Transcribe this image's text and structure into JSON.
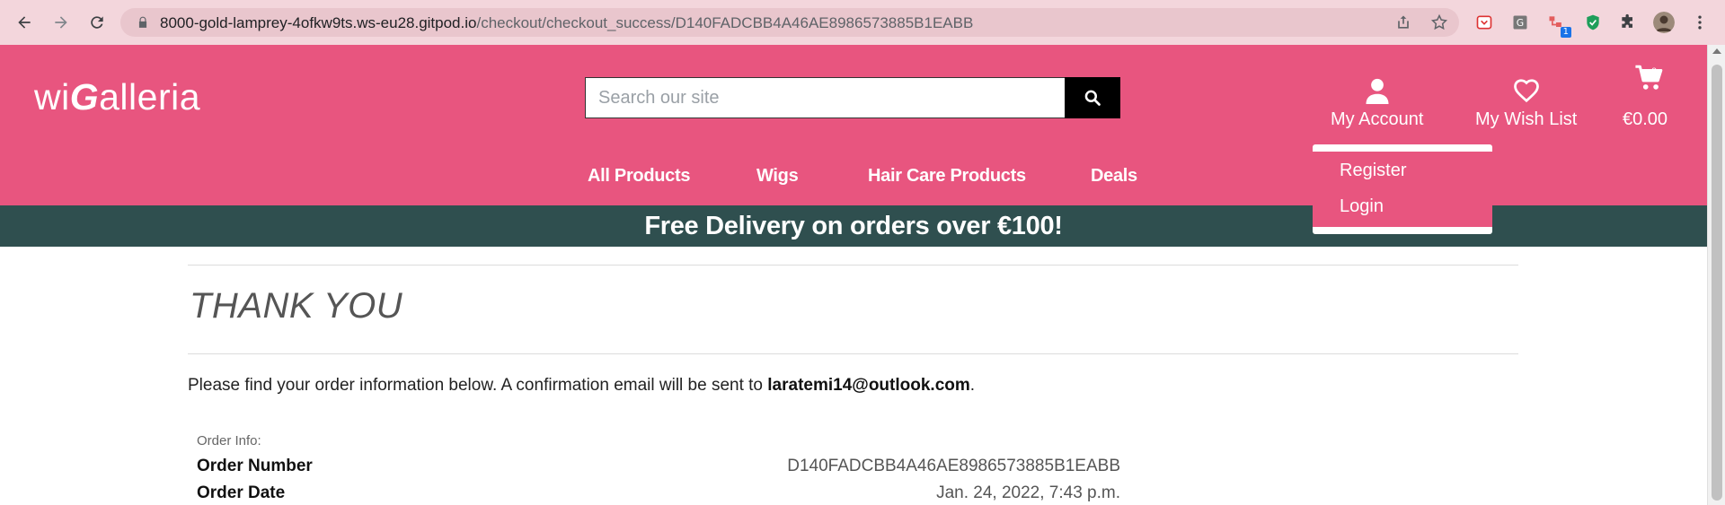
{
  "browser": {
    "url_host": "8000-gold-lamprey-4ofkw9ts.ws-eu28.gitpod.io",
    "url_path": "/checkout/checkout_success/D140FADCBB4A46AE8986573885B1EABB",
    "extension_badge": "1"
  },
  "site": {
    "logo_prefix": "wi",
    "logo_g": "G",
    "logo_suffix": "alleria",
    "search_placeholder": "Search our site",
    "account_label": "My Account",
    "wishlist_label": "My Wish List",
    "cart_count": "0",
    "cart_total": "€0.00",
    "nav": [
      "All Products",
      "Wigs",
      "Hair Care Products",
      "Deals"
    ],
    "dropdown": [
      "Register",
      "Login"
    ],
    "banner": "Free Delivery on orders over €100!"
  },
  "page": {
    "title": "THANK YOU",
    "message_prefix": "Please find your order information below. A confirmation email will be sent to ",
    "email": "laratemi14@outlook.com",
    "message_suffix": ".",
    "order_info_label": "Order Info:",
    "order_number_label": "Order Number",
    "order_number": "D140FADCBB4A46AE8986573885B1EABB",
    "order_date_label": "Order Date",
    "order_date": "Jan. 24, 2022, 7:43 p.m."
  },
  "colors": {
    "brand_pink": "#e8557f",
    "banner": "#2f4f4f",
    "chrome": "#f3d6dc"
  }
}
